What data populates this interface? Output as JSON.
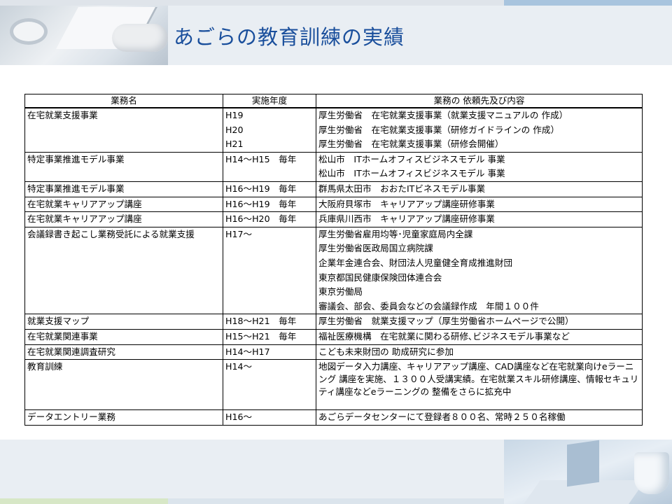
{
  "title": "あごらの教育訓練の実績",
  "table": {
    "headers": [
      "業務名",
      "実施年度",
      "業務の 依頼先及び内容"
    ],
    "rows": [
      {
        "name": "在宅就業支援事業",
        "years": [
          "H19",
          "H20",
          "H21"
        ],
        "details": [
          "厚生労働省　在宅就業支援事業（就業支援マニュアルの 作成）",
          "厚生労働省　在宅就業支援事業（研修ガイドラインの 作成）",
          "厚生労働省　在宅就業支援事業（研修会開催）"
        ]
      },
      {
        "name": "特定事業推進モデル事業",
        "years": [
          "H14～H15　毎年"
        ],
        "details": [
          "松山市　ITホームオフィスビジネスモデル 事業",
          "松山市　ITホームオフィスビジネスモデル 事業"
        ]
      },
      {
        "name": "特定事業推進モデル事業",
        "years": [
          "H16～H19　毎年"
        ],
        "details": [
          "群馬県太田市　おおたITビネスモデル事業"
        ]
      },
      {
        "name": "在宅就業キャリアアップ講座",
        "years": [
          "H16～H19　毎年"
        ],
        "details": [
          "大阪府貝塚市　キャリアアップ講座研修事業"
        ]
      },
      {
        "name": "在宅就業キャリアアップ講座",
        "years": [
          "H16～H20　毎年"
        ],
        "details": [
          "兵庫県川西市　キャリアアップ講座研修事業"
        ]
      },
      {
        "name": "会議録書き起こし業務受託による就業支援",
        "years": [
          "H17～"
        ],
        "details": [
          "厚生労働省雇用均等･児童家庭局内全課",
          "厚生労働省医政局国立病院課",
          "企業年金連合会、財団法人児童健全育成推進財団",
          "東京都国民健康保険団体連合会",
          "東京労働局",
          "審議会、部会、委員会などの会議録作成　年間１００件"
        ]
      },
      {
        "name": "就業支援マップ",
        "years": [
          "H18～H21　毎年"
        ],
        "details": [
          "厚生労働省　就業支援マップ（厚生労働省ホームページで公開）"
        ]
      },
      {
        "name": "在宅就業関連事業",
        "years": [
          "H15～H21　毎年"
        ],
        "details": [
          "福祉医療機構　在宅就業に関わる研修､ビジネスモデル事業など"
        ]
      },
      {
        "name": "在宅就業関連調査研究",
        "years": [
          "H14～H17"
        ],
        "details": [
          "こども未来財団の 助成研究に参加"
        ]
      },
      {
        "name": "教育訓練",
        "years": [
          "H14～"
        ],
        "details": [
          "地図データ入力講座、キャリアアップ講座、CAD講座など在宅就業向けeラーニング 講座を実施、１３００人受講実績。在宅就業スキル研修講座、情報セキュリティ講座などeラーニングの 整備をさらに拡充中"
        ]
      },
      {
        "name": "データエントリー業務",
        "years": [
          "H16～"
        ],
        "details": [
          "あごらデータセンターにて登録者８００名、常時２５０名稼働"
        ]
      }
    ]
  }
}
